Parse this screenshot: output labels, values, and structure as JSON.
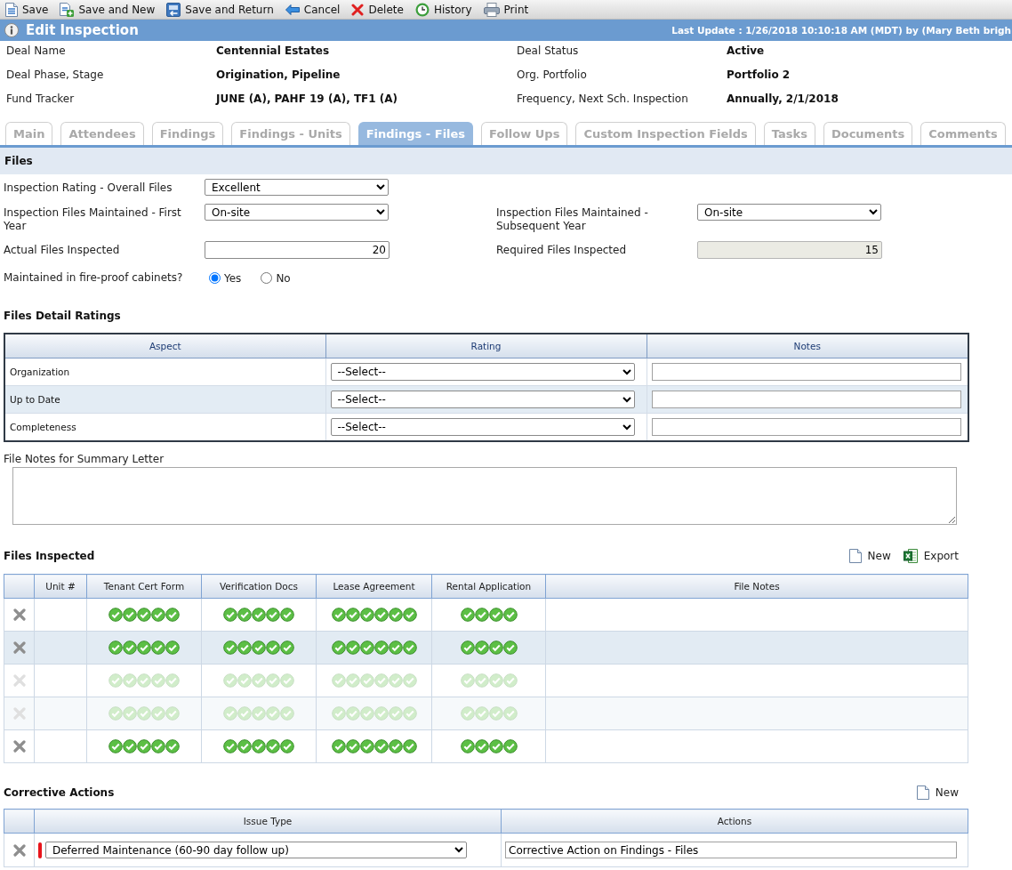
{
  "toolbar": [
    {
      "kind": "save",
      "label": "Save"
    },
    {
      "kind": "save_new",
      "label": "Save and New"
    },
    {
      "kind": "save_return",
      "label": "Save and Return"
    },
    {
      "kind": "cancel",
      "label": "Cancel"
    },
    {
      "kind": "delete",
      "label": "Delete"
    },
    {
      "kind": "history",
      "label": "History"
    },
    {
      "kind": "print",
      "label": "Print"
    }
  ],
  "header": {
    "title": "Edit Inspection",
    "last_update": "Last Update : 1/26/2018 10:10:18 AM (MDT) by (Mary Beth brigh"
  },
  "summary": [
    {
      "label": "Deal Name",
      "value": "Centennial Estates"
    },
    {
      "label": "Deal Status",
      "value": "Active"
    },
    {
      "label": "Deal Phase, Stage",
      "value": "Origination, Pipeline"
    },
    {
      "label": "Org. Portfolio",
      "value": "Portfolio 2"
    },
    {
      "label": "Fund Tracker",
      "value": "JUNE (A), PAHF 19 (A), TF1 (A)"
    },
    {
      "label": "Frequency, Next Sch. Inspection",
      "value": "Annually, 2/1/2018"
    }
  ],
  "tabs": [
    {
      "label": "Main",
      "selected": false
    },
    {
      "label": "Attendees",
      "selected": false
    },
    {
      "label": "Findings",
      "selected": false
    },
    {
      "label": "Findings - Units",
      "selected": false
    },
    {
      "label": "Findings - Files",
      "selected": true
    },
    {
      "label": "Follow Ups",
      "selected": false
    },
    {
      "label": "Custom Inspection Fields",
      "selected": false
    },
    {
      "label": "Tasks",
      "selected": false
    },
    {
      "label": "Documents",
      "selected": false
    },
    {
      "label": "Comments",
      "selected": false
    }
  ],
  "files": {
    "title": "Files",
    "rows": [
      [
        {
          "kind": "select",
          "label": "Inspection Rating - Overall Files",
          "value": "Excellent",
          "disabled": false
        }
      ],
      [
        {
          "kind": "select",
          "label": "Inspection Files Maintained - First Year",
          "value": "On-site",
          "disabled": false
        },
        {
          "kind": "select",
          "label": "Inspection Files Maintained - Subsequent Year",
          "value": "On-site",
          "disabled": false
        }
      ],
      [
        {
          "kind": "number",
          "label": "Actual Files Inspected",
          "value": "20",
          "disabled": false
        },
        {
          "kind": "number",
          "label": "Required Files Inspected",
          "value": "15",
          "disabled": true
        }
      ],
      [
        {
          "kind": "radio",
          "label": "Maintained in fire-proof cabinets?",
          "disabled": false,
          "options": [
            {
              "label": "Yes",
              "selected": true
            },
            {
              "label": "No",
              "selected": false
            }
          ]
        }
      ]
    ]
  },
  "detail_ratings": {
    "title": "Files Detail Ratings",
    "columns": [
      "Aspect",
      "Rating",
      "Notes"
    ],
    "rows": [
      {
        "aspect": "Organization",
        "rating": "--Select--"
      },
      {
        "aspect": "Up to Date",
        "rating": "--Select--"
      },
      {
        "aspect": "Completeness",
        "rating": "--Select--"
      }
    ]
  },
  "summary_notes": {
    "label": "File Notes for Summary Letter"
  },
  "files_inspected": {
    "title": "Files Inspected",
    "actions": [
      {
        "kind": "new",
        "label": "New"
      },
      {
        "kind": "export",
        "label": "Export"
      }
    ],
    "columns": [
      "Unit #",
      "Tenant Cert Form",
      "Verification Docs",
      "Lease Agreement",
      "Rental Application",
      "File Notes"
    ],
    "rows": [
      {
        "faded": false,
        "checks": [
          [
            {
              "checked": true
            },
            {
              "checked": true
            },
            {
              "checked": true
            },
            {
              "checked": true
            },
            {
              "checked": true
            }
          ],
          [
            {
              "checked": true
            },
            {
              "checked": true
            },
            {
              "checked": true
            },
            {
              "checked": true
            },
            {
              "checked": true
            }
          ],
          [
            {
              "checked": true
            },
            {
              "checked": true
            },
            {
              "checked": true
            },
            {
              "checked": true
            },
            {
              "checked": true
            },
            {
              "checked": true
            }
          ],
          [
            {
              "checked": true
            },
            {
              "checked": true
            },
            {
              "checked": true
            },
            {
              "checked": true
            }
          ]
        ]
      },
      {
        "faded": false,
        "checks": [
          [
            {
              "checked": true
            },
            {
              "checked": true
            },
            {
              "checked": true
            },
            {
              "checked": true
            },
            {
              "checked": true
            }
          ],
          [
            {
              "checked": true
            },
            {
              "checked": true
            },
            {
              "checked": true
            },
            {
              "checked": true
            },
            {
              "checked": true
            }
          ],
          [
            {
              "checked": true
            },
            {
              "checked": true
            },
            {
              "checked": true
            },
            {
              "checked": true
            },
            {
              "checked": true
            },
            {
              "checked": true
            }
          ],
          [
            {
              "checked": true
            },
            {
              "checked": true
            },
            {
              "checked": true
            },
            {
              "checked": true
            }
          ]
        ]
      },
      {
        "faded": true,
        "checks": [
          [
            {
              "checked": true
            },
            {
              "checked": true
            },
            {
              "checked": true
            },
            {
              "checked": true
            },
            {
              "checked": true
            }
          ],
          [
            {
              "checked": true
            },
            {
              "checked": true
            },
            {
              "checked": true
            },
            {
              "checked": true
            },
            {
              "checked": true
            }
          ],
          [
            {
              "checked": true
            },
            {
              "checked": true
            },
            {
              "checked": true
            },
            {
              "checked": true
            },
            {
              "checked": true
            },
            {
              "checked": true
            }
          ],
          [
            {
              "checked": true
            },
            {
              "checked": true
            },
            {
              "checked": true
            },
            {
              "checked": true
            }
          ]
        ]
      },
      {
        "faded": true,
        "checks": [
          [
            {
              "checked": true
            },
            {
              "checked": true
            },
            {
              "checked": true
            },
            {
              "checked": true
            },
            {
              "checked": true
            }
          ],
          [
            {
              "checked": true
            },
            {
              "checked": true
            },
            {
              "checked": true
            },
            {
              "checked": true
            },
            {
              "checked": true
            }
          ],
          [
            {
              "checked": true
            },
            {
              "checked": true
            },
            {
              "checked": true
            },
            {
              "checked": true
            },
            {
              "checked": true
            },
            {
              "checked": true
            }
          ],
          [
            {
              "checked": true
            },
            {
              "checked": true
            },
            {
              "checked": true
            },
            {
              "checked": true
            }
          ]
        ]
      },
      {
        "faded": false,
        "checks": [
          [
            {
              "checked": true
            },
            {
              "checked": true
            },
            {
              "checked": true
            },
            {
              "checked": true
            },
            {
              "checked": true
            }
          ],
          [
            {
              "checked": true
            },
            {
              "checked": true
            },
            {
              "checked": true
            },
            {
              "checked": true
            },
            {
              "checked": true
            }
          ],
          [
            {
              "checked": true
            },
            {
              "checked": true
            },
            {
              "checked": true
            },
            {
              "checked": true
            },
            {
              "checked": true
            },
            {
              "checked": true
            }
          ],
          [
            {
              "checked": true
            },
            {
              "checked": true
            },
            {
              "checked": true
            },
            {
              "checked": true
            }
          ]
        ]
      }
    ]
  },
  "corrective_actions": {
    "title": "Corrective Actions",
    "actions": [
      {
        "kind": "new",
        "label": "New"
      }
    ],
    "columns": [
      "Issue Type",
      "Actions"
    ],
    "rows": [
      {
        "required": true,
        "issue_type": "Deferred Maintenance (60-90 day follow up)",
        "action": "Corrective Action on Findings - Files"
      }
    ]
  }
}
